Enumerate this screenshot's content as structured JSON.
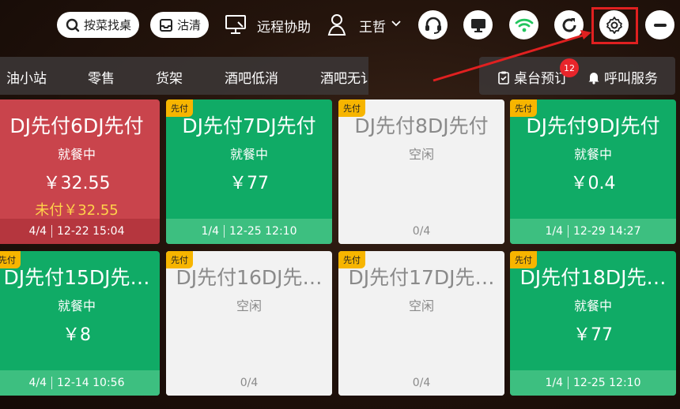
{
  "topbar": {
    "search_label": "按菜找桌",
    "clean_label": "沽清",
    "remote_label": "远程协助",
    "user_name": "王哲"
  },
  "categories": [
    "油小站",
    "零售",
    "货架",
    "酒吧低消",
    "酒吧无讠"
  ],
  "rightbar": {
    "reserve_label": "桌台预订",
    "reserve_badge": "12",
    "call_label": "呼叫服务"
  },
  "tables": [
    {
      "tag": "",
      "name": "DJ先付6DJ先付",
      "status": "就餐中",
      "amount": "￥32.55",
      "unpaid": "未付￥32.55",
      "guests": "4/4",
      "time": "12-22 15:04"
    },
    {
      "tag": "先付",
      "name": "DJ先付7DJ先付",
      "status": "就餐中",
      "amount": "￥77",
      "unpaid": "",
      "guests": "1/4",
      "time": "12-25 12:10"
    },
    {
      "tag": "先付",
      "name": "DJ先付8DJ先付",
      "status": "空闲",
      "amount": "",
      "unpaid": "",
      "guests": "0/4",
      "time": ""
    },
    {
      "tag": "先付",
      "name": "DJ先付9DJ先付",
      "status": "就餐中",
      "amount": "￥0.4",
      "unpaid": "",
      "guests": "1/4",
      "time": "12-29 14:27"
    },
    {
      "tag": "先付",
      "name": "DJ先付15DJ先…",
      "status": "就餐中",
      "amount": "￥8",
      "unpaid": "",
      "guests": "4/4",
      "time": "12-14 10:56"
    },
    {
      "tag": "先付",
      "name": "DJ先付16DJ先…",
      "status": "空闲",
      "amount": "",
      "unpaid": "",
      "guests": "0/4",
      "time": ""
    },
    {
      "tag": "先付",
      "name": "DJ先付17DJ先…",
      "status": "空闲",
      "amount": "",
      "unpaid": "",
      "guests": "0/4",
      "time": ""
    },
    {
      "tag": "先付",
      "name": "DJ先付18DJ先…",
      "status": "就餐中",
      "amount": "￥77",
      "unpaid": "",
      "guests": "1/4",
      "time": "12-25 12:10"
    }
  ]
}
